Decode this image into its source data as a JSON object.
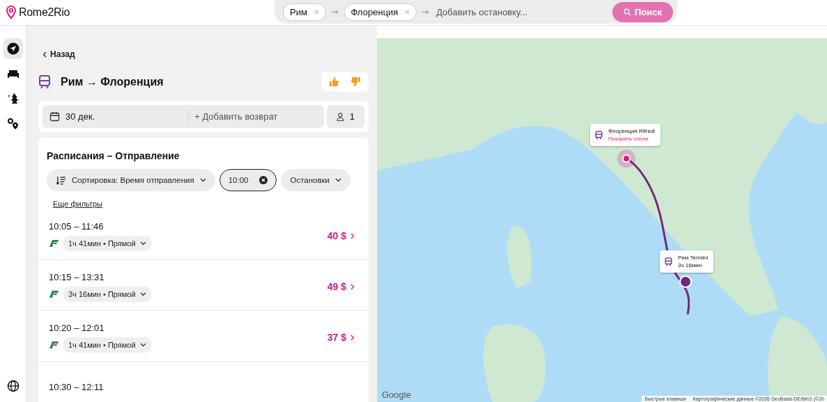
{
  "header": {
    "logo": "Rome2Rio",
    "stops": [
      {
        "label": "Рим"
      },
      {
        "label": "Флоренция"
      }
    ],
    "add_stop": {
      "placeholder": "Добавить остановку..."
    },
    "search_button": "Поиск"
  },
  "rail": [
    {
      "kind": "navigate",
      "selected": true
    },
    {
      "kind": "hotel",
      "selected": false
    },
    {
      "kind": "activity",
      "selected": false
    },
    {
      "kind": "route",
      "selected": false
    },
    {
      "kind": "language",
      "selected": false
    }
  ],
  "back": "Назад",
  "title": "Рим → Флоренция",
  "trip": {
    "date": "30 дек.",
    "return": "+ Добавить возврат",
    "passengers": "1"
  },
  "schedules": {
    "title": "Расписания – Отправление",
    "filters": [
      {
        "kind": "sort",
        "label": "Сортировка: Время отправления"
      },
      {
        "kind": "time",
        "label": "10:00"
      },
      {
        "kind": "dropdown",
        "label": "Остановки"
      }
    ],
    "more_filters": "Еще фильтры",
    "rows": [
      {
        "times": "10:05 – 11:46",
        "details": "1ч 41мин • Прямой",
        "price": "40 $"
      },
      {
        "times": "10:15 – 13:31",
        "details": "3ч 16мин • Прямой",
        "price": "49 $"
      },
      {
        "times": "10:20 – 12:01",
        "details": "1ч 41мин • Прямой",
        "price": "37 $"
      },
      {
        "times": "10:30 – 12:11"
      }
    ]
  },
  "map": {
    "popups": [
      {
        "kind": "destination",
        "name": "Флоренция Rifredi",
        "link": "Показать отели"
      },
      {
        "kind": "origin",
        "name": "Рим Termini",
        "duration": "3ч 16мин"
      }
    ],
    "logo": "Google",
    "shortcuts": "Быстрые клавиши",
    "attribution": "Картографические данные ©2026 GeoBasis-DE/BKG (©20"
  }
}
